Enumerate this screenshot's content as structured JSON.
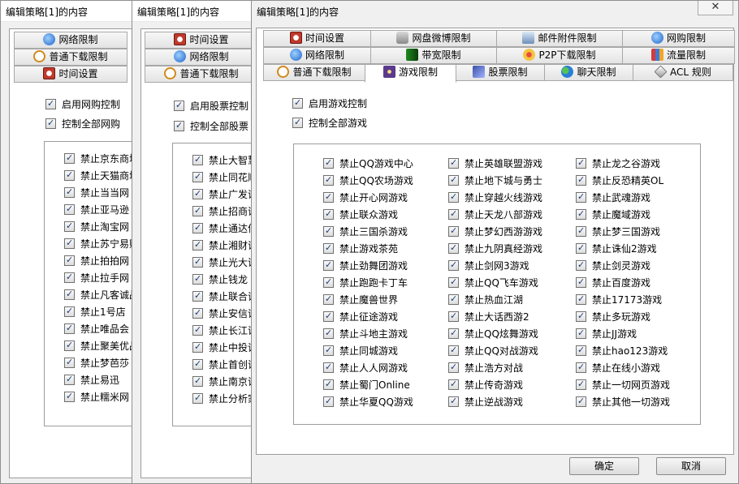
{
  "window_title": "编辑策略[1]的内容",
  "close_glyph": "✕",
  "win1": {
    "tabs": [
      "网络限制",
      "普通下载限制",
      "时间设置"
    ],
    "options": [
      "启用网购控制",
      "控制全部网购"
    ],
    "items": [
      "禁止京东商城",
      "禁止天猫商城",
      "禁止当当网",
      "禁止亚马逊",
      "禁止淘宝网",
      "禁止苏宁易购",
      "禁止拍拍网",
      "禁止拉手网",
      "禁止凡客诚品",
      "禁止1号店",
      "禁止唯品会",
      "禁止聚美优品",
      "禁止梦芭莎",
      "禁止易迅",
      "禁止糯米网"
    ]
  },
  "win2": {
    "tabs": [
      "时间设置",
      "网络限制",
      "普通下载限制"
    ],
    "options": [
      "启用股票控制",
      "控制全部股票"
    ],
    "items": [
      "禁止大智慧",
      "禁止同花顺",
      "禁止广发证券",
      "禁止招商证券",
      "禁止通达信",
      "禁止湘财证券",
      "禁止光大证券",
      "禁止钱龙",
      "禁止联合证券",
      "禁止安信证券",
      "禁止长江证券",
      "禁止中投证券",
      "禁止首创证券",
      "禁止南京证券",
      "禁止分析家"
    ]
  },
  "win3": {
    "tabs_row1": [
      {
        "label": "时间设置",
        "icon": "clock-icon"
      },
      {
        "label": "网盘微博限制",
        "icon": "disk-icon"
      },
      {
        "label": "邮件附件限制",
        "icon": "mail-icon"
      },
      {
        "label": "网购限制",
        "icon": "shop-icon"
      }
    ],
    "tabs_row2": [
      {
        "label": "网络限制",
        "icon": "globe-icon"
      },
      {
        "label": "带宽限制",
        "icon": "bandwidth-icon"
      },
      {
        "label": "P2P下载限制",
        "icon": "p2p-icon"
      },
      {
        "label": "流量限制",
        "icon": "traffic-icon"
      }
    ],
    "tabs_row3": [
      {
        "label": "普通下载限制",
        "icon": "download-icon"
      },
      {
        "label": "游戏限制",
        "icon": "game-icon"
      },
      {
        "label": "股票限制",
        "icon": "stock-icon"
      },
      {
        "label": "聊天限制",
        "icon": "chat-icon"
      },
      {
        "label": "ACL 规则",
        "icon": "acl-icon"
      }
    ],
    "options": [
      "启用游戏控制",
      "控制全部游戏"
    ],
    "games": [
      [
        "禁止QQ游戏中心",
        "禁止QQ农场游戏",
        "禁止开心网游戏",
        "禁止联众游戏",
        "禁止三国杀游戏",
        "禁止游戏茶苑",
        "禁止劲舞团游戏",
        "禁止跑跑卡丁车",
        "禁止魔兽世界",
        "禁止征途游戏",
        "禁止斗地主游戏",
        "禁止同城游戏",
        "禁止人人网游戏",
        "禁止蜀门Online",
        "禁止华夏QQ游戏"
      ],
      [
        "禁止英雄联盟游戏",
        "禁止地下城与勇士",
        "禁止穿越火线游戏",
        "禁止天龙八部游戏",
        "禁止梦幻西游游戏",
        "禁止九阴真经游戏",
        "禁止剑网3游戏",
        "禁止QQ飞车游戏",
        "禁止热血江湖",
        "禁止大话西游2",
        "禁止QQ炫舞游戏",
        "禁止QQ对战游戏",
        "禁止浩方对战",
        "禁止传奇游戏",
        "禁止逆战游戏"
      ],
      [
        "禁止龙之谷游戏",
        "禁止反恐精英OL",
        "禁止武魂游戏",
        "禁止魔域游戏",
        "禁止梦三国游戏",
        "禁止诛仙2游戏",
        "禁止剑灵游戏",
        "禁止百度游戏",
        "禁止17173游戏",
        "禁止多玩游戏",
        "禁止JJ游戏",
        "禁止hao123游戏",
        "禁止在线小游戏",
        "禁止一切网页游戏",
        "禁止其他一切游戏"
      ]
    ],
    "ok_label": "确定",
    "cancel_label": "取消"
  }
}
